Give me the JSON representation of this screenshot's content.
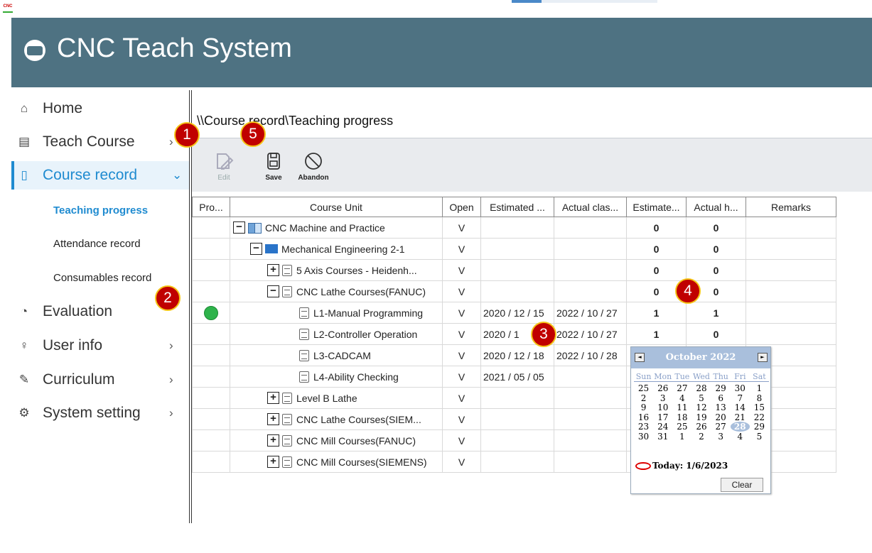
{
  "app": {
    "icon_label": "CNC",
    "title": "CNC Teach System",
    "icon": "cnc-logo-icon"
  },
  "sidebar": {
    "items": [
      {
        "label": "Home",
        "icon": "home-icon"
      },
      {
        "label": "Teach Course",
        "icon": "course-icon"
      },
      {
        "label": "Course record",
        "icon": "document-icon"
      },
      {
        "label": "Evaluation",
        "icon": "pie-chart-icon"
      },
      {
        "label": "User info",
        "icon": "user-icon"
      },
      {
        "label": "Curriculum",
        "icon": "pencil-icon"
      },
      {
        "label": "System setting",
        "icon": "gear-icon"
      }
    ],
    "sub_items": [
      {
        "label": "Teaching progress"
      },
      {
        "label": "Attendance record"
      },
      {
        "label": "Consumables record"
      }
    ]
  },
  "breadcrumb": "\\\\Course record\\Teaching progress",
  "toolbar": {
    "edit_label": "Edit",
    "save_label": "Save",
    "abandon_label": "Abandon"
  },
  "table": {
    "columns": [
      "Pro...",
      "Course Unit",
      "Open",
      "Estimated ...",
      "Actual clas...",
      "Estimate...",
      "Actual h...",
      "Remarks"
    ],
    "rows": [
      {
        "progress": "",
        "toggle": "−",
        "icon": "book",
        "unit": "CNC Machine and Practice",
        "open": "V",
        "est_date": "",
        "act_date": "",
        "est_h": "0",
        "act_h": "0",
        "remarks": ""
      },
      {
        "progress": "",
        "toggle": "−",
        "icon": "class",
        "unit": "Mechanical Engineering 2-1",
        "open": "V",
        "est_date": "",
        "act_date": "",
        "est_h": "0",
        "act_h": "0",
        "remarks": ""
      },
      {
        "progress": "",
        "toggle": "+",
        "icon": "doc",
        "unit": "5 Axis Courses - Heidenh...",
        "open": "V",
        "est_date": "",
        "act_date": "",
        "est_h": "0",
        "act_h": "0",
        "remarks": ""
      },
      {
        "progress": "",
        "toggle": "−",
        "icon": "doc",
        "unit": "CNC Lathe Courses(FANUC)",
        "open": "V",
        "est_date": "",
        "act_date": "",
        "est_h": "0",
        "act_h": "0",
        "remarks": ""
      },
      {
        "progress": "done",
        "toggle": "",
        "icon": "doc",
        "unit": "L1-Manual Programming",
        "open": "V",
        "est_date": "2020 / 12 / 15",
        "act_date": "2022 / 10 / 27",
        "est_h": "1",
        "act_h": "1",
        "remarks": ""
      },
      {
        "progress": "",
        "toggle": "",
        "icon": "doc",
        "unit": "L2-Controller Operation",
        "open": "V",
        "est_date": "2020 / 1",
        "act_date": "2022 / 10 / 27",
        "est_h": "1",
        "act_h": "0",
        "remarks": ""
      },
      {
        "progress": "",
        "toggle": "",
        "icon": "doc",
        "unit": "L3-CADCAM",
        "open": "V",
        "est_date": "2020 / 12 / 18",
        "act_date": "2022 / 10 / 28",
        "est_h": "",
        "act_h": "",
        "remarks": ""
      },
      {
        "progress": "",
        "toggle": "",
        "icon": "doc",
        "unit": "L4-Ability Checking",
        "open": "V",
        "est_date": "2021 / 05 / 05",
        "act_date": "",
        "est_h": "",
        "act_h": "",
        "remarks": ""
      },
      {
        "progress": "",
        "toggle": "+",
        "icon": "doc",
        "unit": "Level B Lathe",
        "open": "V",
        "est_date": "",
        "act_date": "",
        "est_h": "",
        "act_h": "",
        "remarks": ""
      },
      {
        "progress": "",
        "toggle": "+",
        "icon": "doc",
        "unit": "CNC Lathe Courses(SIEM...",
        "open": "V",
        "est_date": "",
        "act_date": "",
        "est_h": "",
        "act_h": "",
        "remarks": ""
      },
      {
        "progress": "",
        "toggle": "+",
        "icon": "doc",
        "unit": "CNC Mill Courses(FANUC)",
        "open": "V",
        "est_date": "",
        "act_date": "",
        "est_h": "",
        "act_h": "",
        "remarks": ""
      },
      {
        "progress": "",
        "toggle": "+",
        "icon": "doc",
        "unit": "CNC Mill Courses(SIEMENS)",
        "open": "V",
        "est_date": "",
        "act_date": "",
        "est_h": "",
        "act_h": "",
        "remarks": ""
      }
    ],
    "indent_levels": [
      0,
      1,
      2,
      2,
      3,
      3,
      3,
      3,
      2,
      2,
      2,
      2
    ]
  },
  "calendar": {
    "title": "October 2022",
    "prev": "◄",
    "next": "►",
    "dows": [
      "Sun",
      "Mon",
      "Tue",
      "Wed",
      "Thu",
      "Fri",
      "Sat"
    ],
    "days": [
      "25",
      "26",
      "27",
      "28",
      "29",
      "30",
      "1",
      "2",
      "3",
      "4",
      "5",
      "6",
      "7",
      "8",
      "9",
      "10",
      "11",
      "12",
      "13",
      "14",
      "15",
      "16",
      "17",
      "18",
      "19",
      "20",
      "21",
      "22",
      "23",
      "24",
      "25",
      "26",
      "27",
      "28",
      "29",
      "30",
      "31",
      "1",
      "2",
      "3",
      "4",
      "5"
    ],
    "selected_day": "28",
    "today_label": "Today: 1/6/2023",
    "clear_label": "Clear"
  },
  "callouts": [
    "1",
    "2",
    "3",
    "4",
    "5"
  ],
  "colors": {
    "header": "#4e7282",
    "accent": "#1f8bd0",
    "progress_done": "#2eb34b",
    "callout": "#c00000"
  }
}
